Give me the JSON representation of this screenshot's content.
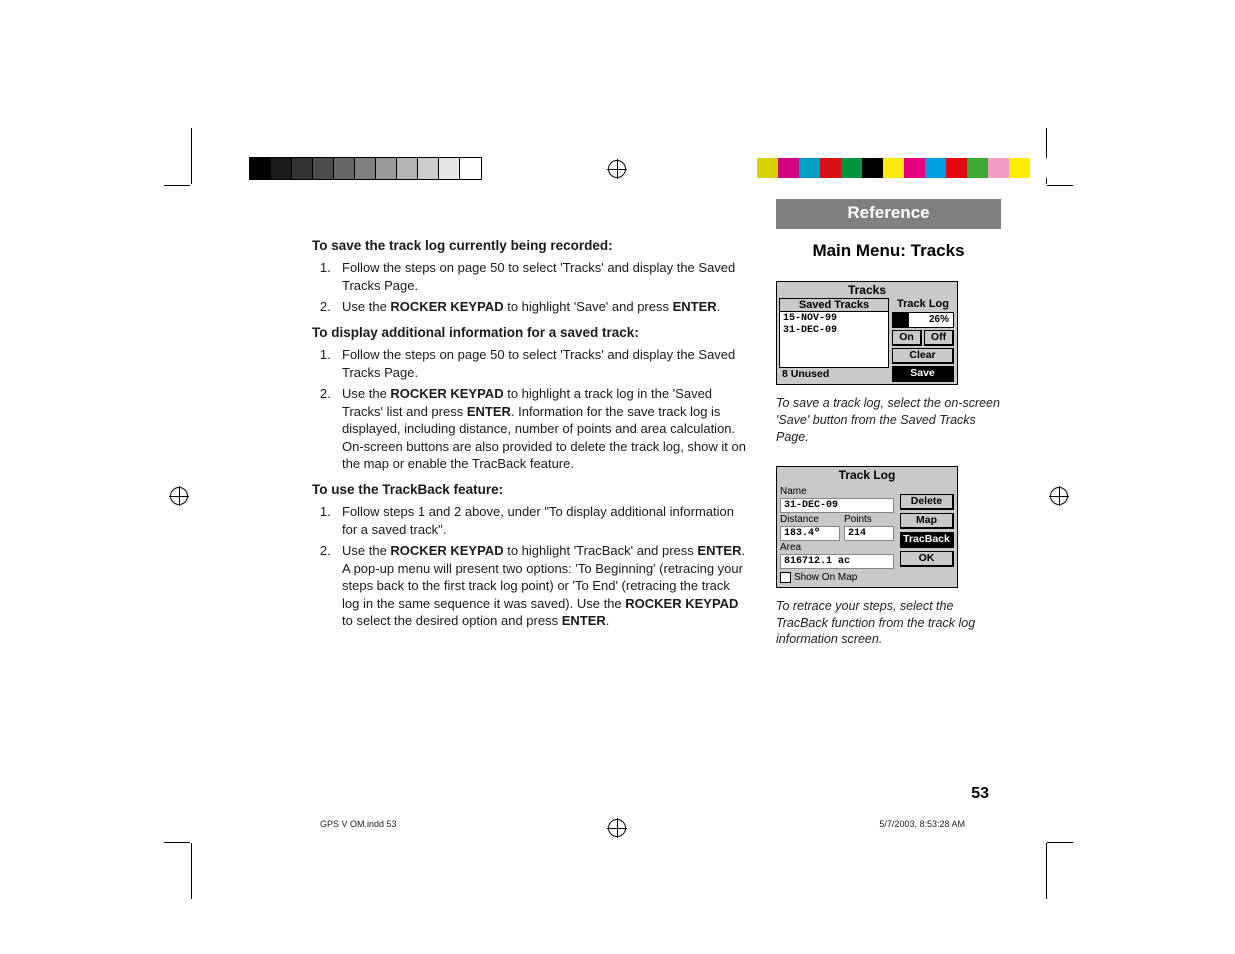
{
  "header": {
    "reference": "Reference",
    "section": "Main Menu: Tracks"
  },
  "left": {
    "h1": "To save the track log currently being recorded:",
    "s1_li1": "Follow the steps on page 50 to select 'Tracks' and display the Saved Tracks Page.",
    "s1_li2_a": "Use the ",
    "s1_li2_b": "ROCKER KEYPAD",
    "s1_li2_c": " to highlight 'Save' and press ",
    "s1_li2_d": "ENTER",
    "s1_li2_e": ".",
    "h2": "To display additional information for a saved track:",
    "s2_li1": "Follow the steps on page 50 to select 'Tracks' and display the Saved Tracks Page.",
    "s2_li2_a": "Use the ",
    "s2_li2_b": "ROCKER KEYPAD",
    "s2_li2_c": " to highlight a track log in the 'Saved Tracks' list and press ",
    "s2_li2_d": "ENTER",
    "s2_li2_e": ". Information for the save track log is displayed, including distance, number of points and area calculation. On-screen buttons are also provided to delete the track log, show it on the map or enable the TracBack feature.",
    "h3": "To use the TrackBack feature:",
    "s3_li1": "Follow steps 1 and 2 above, under \"To display additional information for a saved track\".",
    "s3_li2_a": "Use the ",
    "s3_li2_b": "ROCKER KEYPAD",
    "s3_li2_c": " to highlight 'TracBack' and press ",
    "s3_li2_d": "ENTER",
    "s3_li2_e": ". A pop-up menu will present two options: 'To Beginning' (retracing your steps back to the first track log point) or 'To End' (retracing the track log in the same sequence it was saved). Use the ",
    "s3_li2_f": "ROCKER KEYPAD",
    "s3_li2_g": " to select the desired option and press ",
    "s3_li2_h": "ENTER",
    "s3_li2_i": "."
  },
  "gps1": {
    "title": "Tracks",
    "saved_hdr": "Saved Tracks",
    "saved_item1": "15-NOV-99",
    "saved_item2": "31-DEC-09",
    "unused": "8 Unused",
    "tl_hdr": "Track Log",
    "pct_label": "26%",
    "on": "On",
    "off": "Off",
    "clear": "Clear",
    "save": "Save"
  },
  "caption1": "To save a track log, select the on-screen 'Save' button from the Saved Tracks Page.",
  "gps2": {
    "title": "Track Log",
    "name_lbl": "Name",
    "name_val": "31-DEC-09",
    "dist_lbl": "Distance",
    "dist_val": "183.4º",
    "pts_lbl": "Points",
    "pts_val": "214",
    "area_lbl": "Area",
    "area_val": "816712.1 ac",
    "show_on_map": "Show On Map",
    "delete": "Delete",
    "map": "Map",
    "tracback": "TracBack",
    "ok": "OK"
  },
  "caption2": "To retrace your steps, select the TracBack function from the track log information screen.",
  "page_number": "53",
  "footer": {
    "left": "GPS V OM.indd   53",
    "right": "5/7/2003, 8:53:28 AM"
  },
  "print_swatches": {
    "gray": [
      "#000000",
      "#1a1a1a",
      "#333333",
      "#4d4d4d",
      "#666666",
      "#808080",
      "#999999",
      "#b3b3b3",
      "#cccccc",
      "#e6e6e6",
      "#ffffff"
    ],
    "color": [
      "#d8d200",
      "#d4007f",
      "#00a0c6",
      "#d51317",
      "#009640",
      "#000000",
      "#fcea0d",
      "#e6007e",
      "#009fe3",
      "#e30613",
      "#3aaa35",
      "#f29ec4",
      "#ffed00",
      "#ffffff"
    ]
  }
}
